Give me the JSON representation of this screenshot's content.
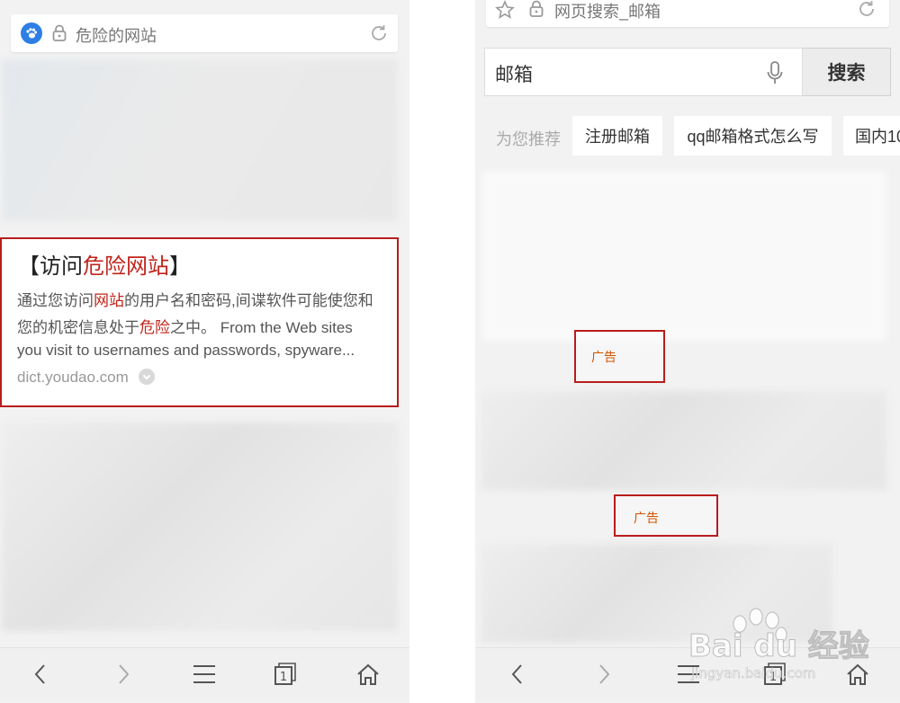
{
  "left": {
    "url_title": "危险的网站",
    "result": {
      "title_prefix": "【访问",
      "title_highlight": "危险网站",
      "title_suffix": "】",
      "line1_a": "通过您访问",
      "line1_hl": "网站",
      "line1_b": "的用户名和密码,间谍软件可能使您和",
      "line2_a": "您的机密信息处于",
      "line2_hl": "危险",
      "line2_b": "之中。 From the Web sites",
      "line3": "you visit to usernames and passwords, spyware...",
      "source": "dict.youdao.com"
    },
    "nav": {
      "tab_count": "1"
    }
  },
  "right": {
    "url_title": "网页搜索_邮箱",
    "search": {
      "query": "邮箱",
      "button": "搜索"
    },
    "recommend": {
      "label": "为您推荐",
      "chips": [
        "注册邮箱",
        "qq邮箱格式怎么写",
        "国内10"
      ]
    },
    "ads": [
      "广告",
      "广告"
    ],
    "nav": {
      "tab_count": "1"
    }
  },
  "watermark": {
    "brand": "Bai du 经验",
    "url": "jingyan.baidu.com"
  },
  "colors": {
    "highlight": "#c0241b",
    "annotation": "#b91c1c",
    "ad_text": "#d35400"
  }
}
